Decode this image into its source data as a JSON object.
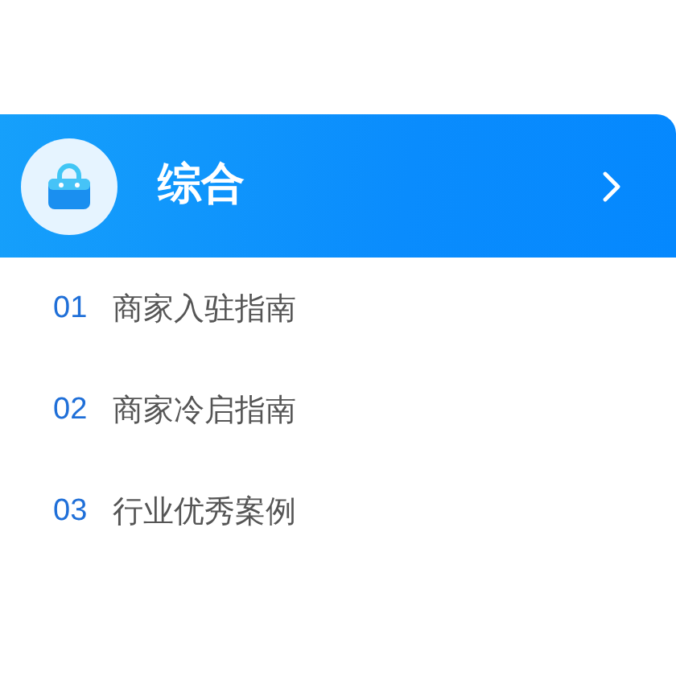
{
  "header": {
    "title": "综合"
  },
  "items": [
    {
      "number": "01",
      "label": "商家入驻指南"
    },
    {
      "number": "02",
      "label": "商家冷启指南"
    },
    {
      "number": "03",
      "label": "行业优秀案例"
    }
  ]
}
